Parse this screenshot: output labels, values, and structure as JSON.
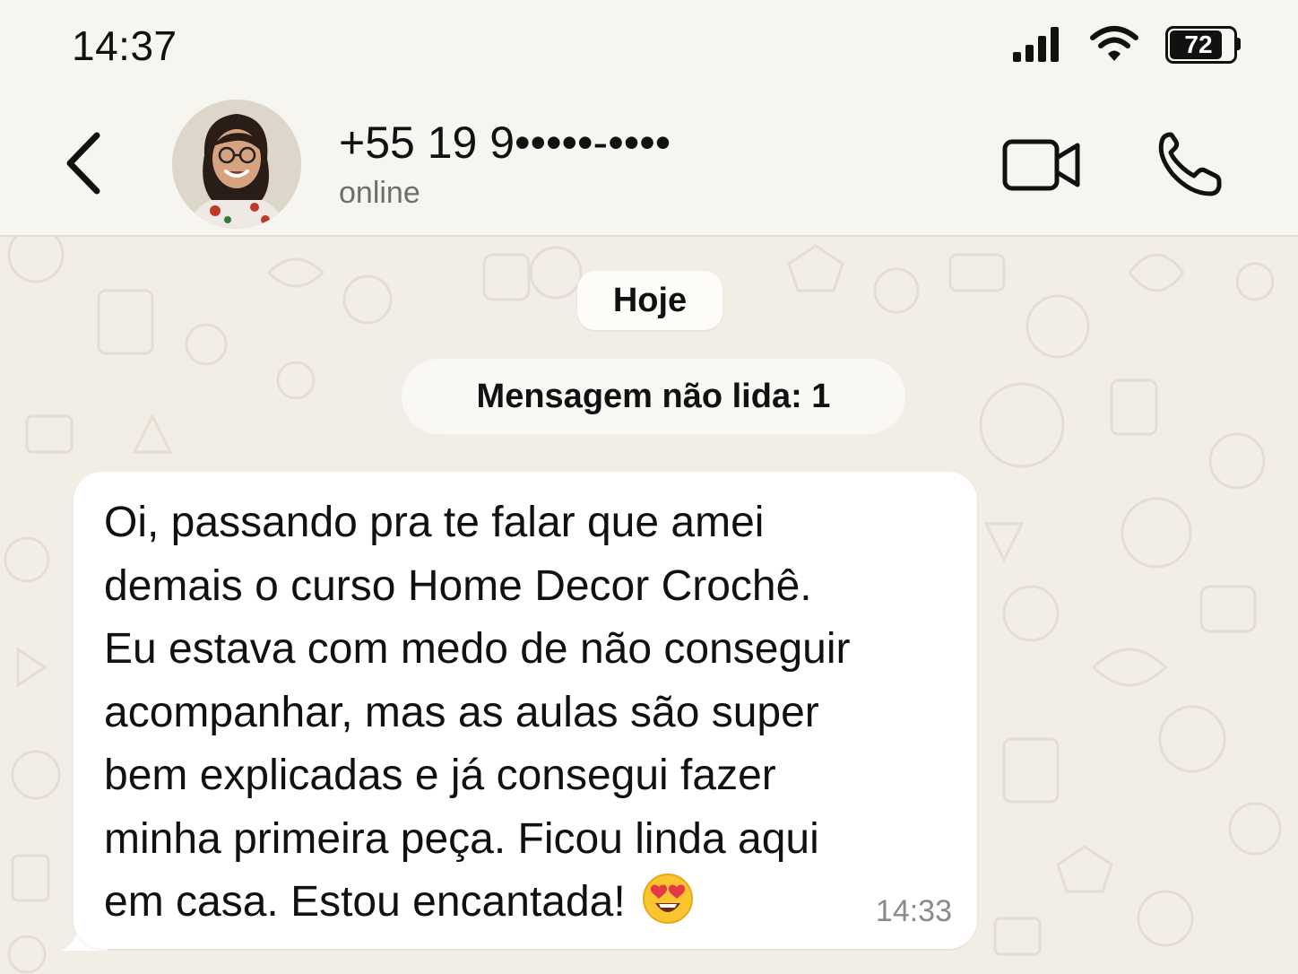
{
  "status_bar": {
    "time": "14:37",
    "battery_level": "72",
    "icons": [
      "signal-icon",
      "wifi-icon",
      "battery-icon"
    ]
  },
  "header": {
    "contact_name": "+55 19 9•••••-••••",
    "contact_status": "online",
    "icons": [
      "back-arrow-icon",
      "video-camera-icon",
      "phone-icon"
    ]
  },
  "chat": {
    "date_label": "Hoje",
    "unread_label": "Mensagem não lida: 1",
    "messages": [
      {
        "lines": [
          "Oi, passando pra te falar que amei",
          "demais o curso Home Decor Crochê.",
          "Eu estava com medo de não conseguir",
          "acompanhar, mas as aulas são super",
          "bem explicadas e já consegui fazer",
          "minha primeira peça. Ficou linda aqui",
          "em casa. Estou encantada!"
        ],
        "emoji": "heart-eyes-emoji",
        "time": "14:33"
      }
    ]
  },
  "colors": {
    "background": "#f2ede5",
    "header": "#f7f5f0",
    "bubble": "#ffffff",
    "secondary_text": "#6e6e6e"
  }
}
